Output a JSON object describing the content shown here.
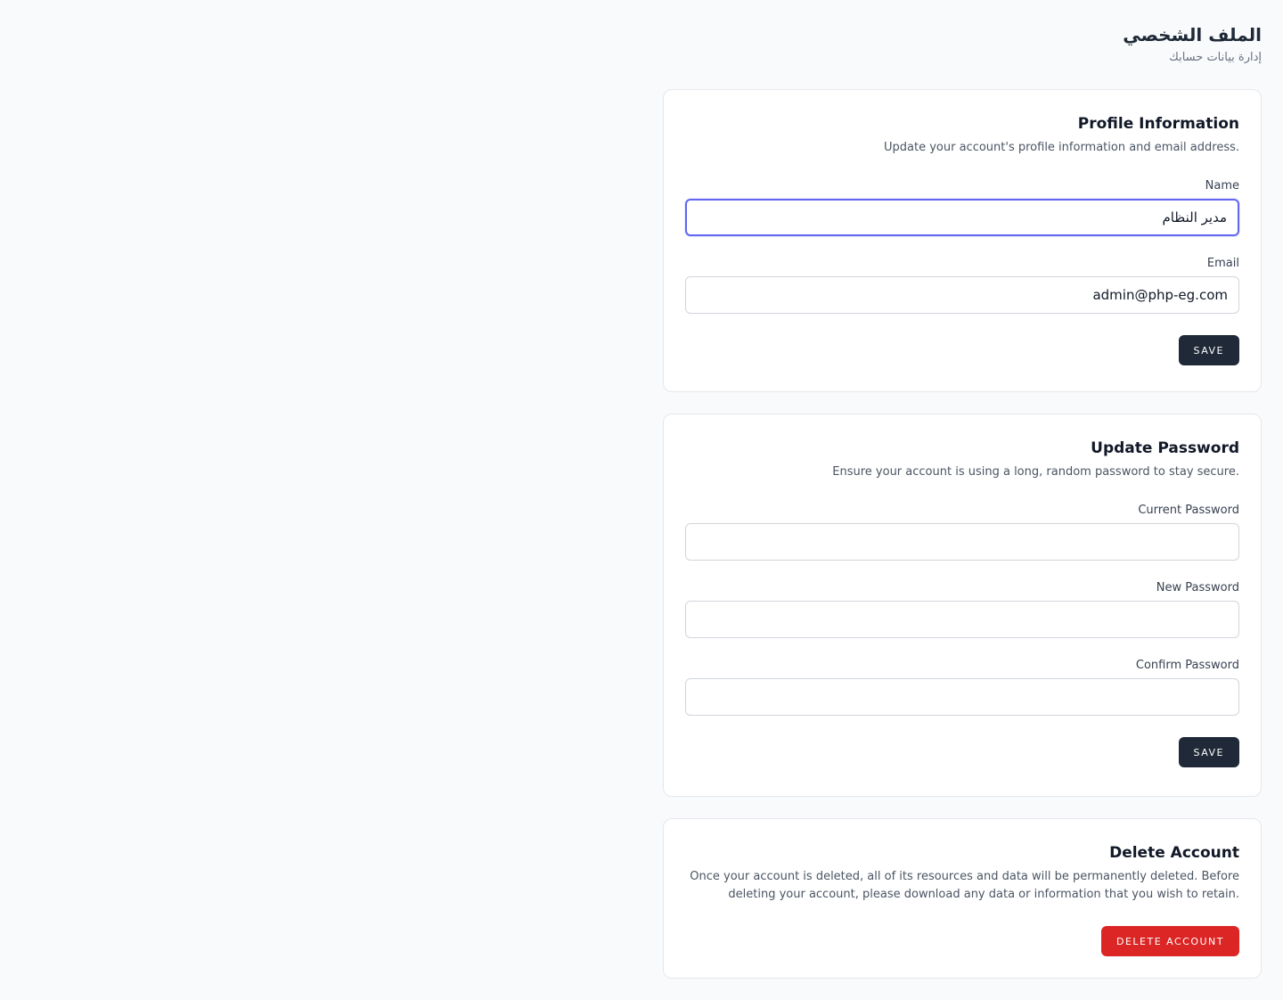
{
  "header": {
    "title": "الملف الشخصي",
    "subtitle": "إدارة بيانات حسابك"
  },
  "profile": {
    "title": "Profile Information",
    "description": "Update your account's profile information and email address.",
    "name_label": "Name",
    "name_value": "مدير النظام",
    "email_label": "Email",
    "email_value": "admin@php-eg.com",
    "save_label": "SAVE"
  },
  "password": {
    "title": "Update Password",
    "description": "Ensure your account is using a long, random password to stay secure.",
    "current_label": "Current Password",
    "current_value": "",
    "new_label": "New Password",
    "new_value": "",
    "confirm_label": "Confirm Password",
    "confirm_value": "",
    "save_label": "SAVE"
  },
  "delete": {
    "title": "Delete Account",
    "description": "Once your account is deleted, all of its resources and data will be permanently deleted. Before deleting your account, please download any data or information that you wish to retain.",
    "button_label": "DELETE ACCOUNT"
  },
  "colors": {
    "primary_button": "#1f2937",
    "danger_button": "#dc2626",
    "focus_ring": "#6366f1",
    "background": "#f8fafc"
  }
}
